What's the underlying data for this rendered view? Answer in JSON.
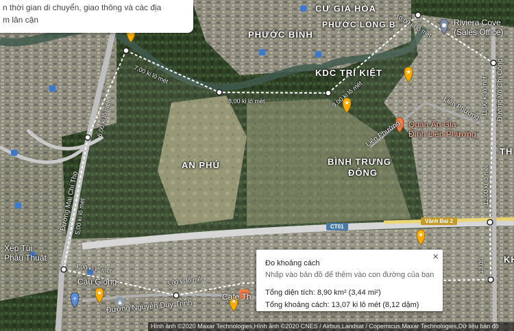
{
  "top_card": {
    "line1": "n thời gian di chuyển, giao thông và các địa",
    "line2": "m lân cận"
  },
  "area_labels": {
    "cu_gia_hoa": "CƯ GIA HÒA",
    "phuoc_binh": "PHƯỚC BÌNH",
    "phuoc_long_b": "PHƯỚC LONG B",
    "kdc_tri_kiet": "KDC TRÍ KIỆT",
    "an_phu": "AN PHÚ",
    "binh_trung_dong_1": "BÌNH TRƯNG",
    "binh_trung_dong_2": "ĐÔNG",
    "th": "TH",
    "kh": "KH"
  },
  "poi": {
    "riviera_1": "Riviera Cove",
    "riviera_2": "(Sales Office)",
    "quan_an_1": "Quán Ăn Gia",
    "quan_an_2": "Đình Liên Phương",
    "xep_tui_1": "Xẹp Túi",
    "xep_tui_2": "Phẫu Thuật",
    "cau_giong": "Cầu Giồng",
    "cafe": "Cafe Th"
  },
  "streets": {
    "mai_chi_tho": "Đường Mai Chí Thọ",
    "vo_chi_cong": "Đường Võ Chí Công",
    "lien_phuong_1": "Liên Phường",
    "lien_phuong_2": "Liên Phường",
    "nguyen_duy_trinh": "Đường Nguyễn Duy Trinh",
    "ct01": "CT01",
    "vanh_dai_2": "Vành Đai 2"
  },
  "segments": {
    "s1": "7,00 ki lô mét",
    "s2": "8,00 ki lô mét",
    "s3": "9,00 ki lô mét",
    "s4": "10,00 ki lô mét",
    "s5": "11,00 ki lô mét",
    "s6": "12,00 ki lô mét",
    "s7": "13,00",
    "s8": "3,00 ki lô mét",
    "s9": "4,00 ki lô mét",
    "s10": "5,00 ki lô mét",
    "s11": "6,00 ki lô mét"
  },
  "measure_panel": {
    "title": "Đo khoảng cách",
    "hint": "Nhấp vào bản đồ để thêm vào con đường của bạn",
    "area": "Tổng diện tích: 8,90 km² (3,44 mi²)",
    "distance": "Tổng khoảng cách: 13,07 ki lô mét (8,12 dặm)",
    "close": "×"
  },
  "footer": "Hình ảnh ©2020 Maxar Technologies,Hình ảnh ©2020 CNES / Airbus,Landsat / Copernicus,Maxar Technologies,Dữ liệu bản đồ",
  "colors": {
    "pin_yellow": "#f9ab00",
    "pin_blue": "#5b8dd6",
    "pin_orange": "#f27c44",
    "route_white": "#ffffff",
    "road_yellow": "#e9d36a"
  }
}
